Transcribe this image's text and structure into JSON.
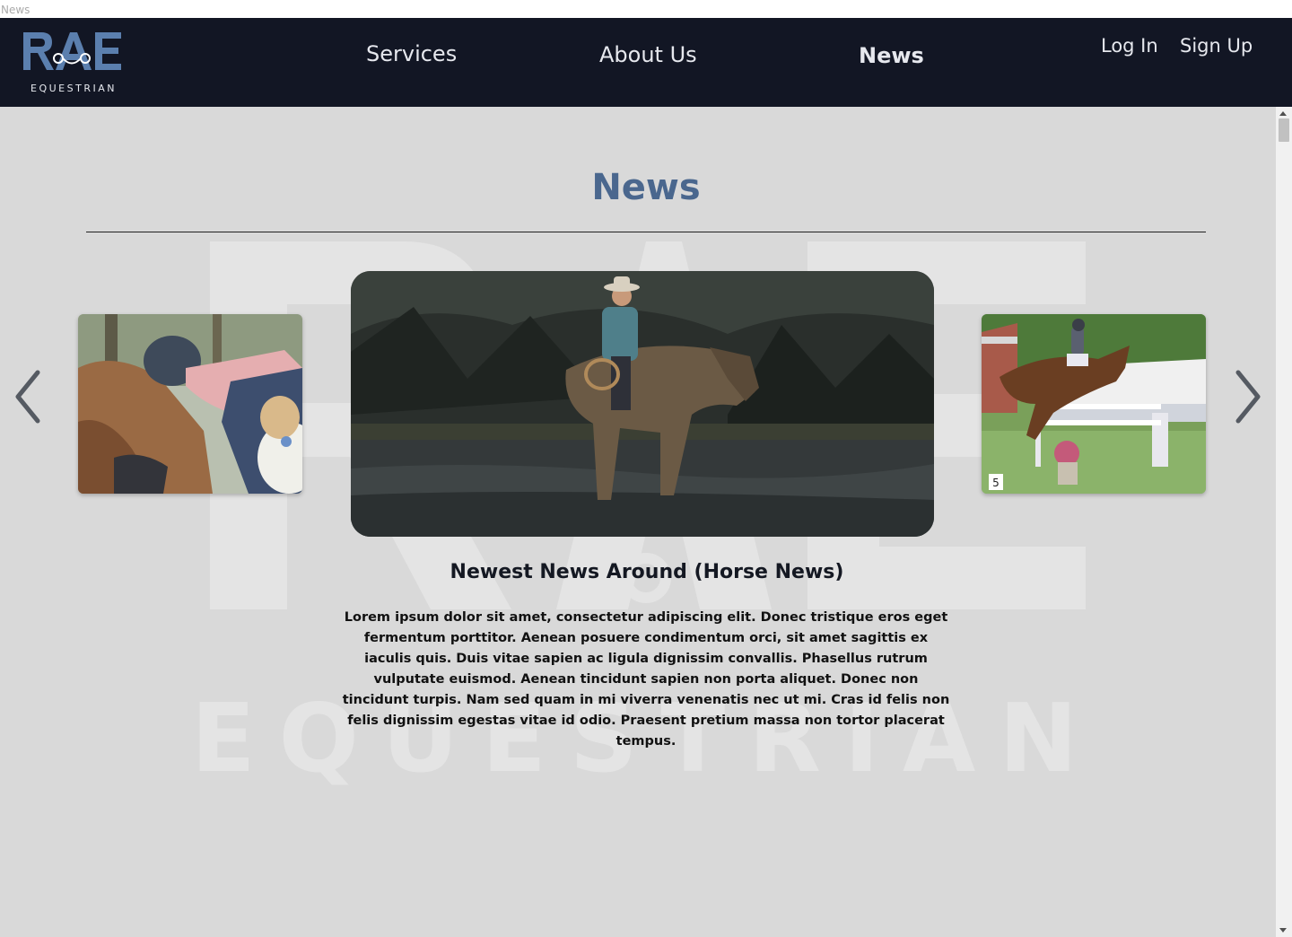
{
  "tab": {
    "title": "News"
  },
  "nav": {
    "logo_text": "RAE",
    "logo_subtext": "EQUESTRIAN",
    "links": [
      "Services",
      "About Us",
      "News"
    ],
    "active": "News",
    "login": "Log In",
    "signup": "Sign Up"
  },
  "page": {
    "heading": "News",
    "watermark_text": "EQUESTRIAN"
  },
  "carousel": {
    "prev_icon": "chevron-left-icon",
    "next_icon": "chevron-right-icon",
    "slides": [
      {
        "position": "left",
        "image": "rider-hugging-horse-photo"
      },
      {
        "position": "center",
        "image": "cowboy-on-horse-in-river-photo"
      },
      {
        "position": "right",
        "image": "show-jumping-horse-photo"
      }
    ]
  },
  "article": {
    "title": "Newest News Around (Horse News)",
    "body": "Lorem ipsum dolor sit amet, consectetur adipiscing elit. Donec tristique eros eget fermentum porttitor. Aenean posuere condimentum orci, sit amet sagittis ex iaculis quis. Duis vitae sapien ac ligula dignissim convallis. Phasellus rutrum vulputate euismod. Aenean tincidunt sapien non porta aliquet. Donec non tincidunt turpis. Nam sed quam in mi viverra venenatis nec ut mi. Cras id felis non felis dignissim egestas vitae id odio. Praesent pretium massa non tortor placerat tempus."
  },
  "colors": {
    "nav_bg": "#121624",
    "page_bg": "#d9d9d9",
    "heading": "#4a678e",
    "logo_blue": "#5b7fae"
  }
}
